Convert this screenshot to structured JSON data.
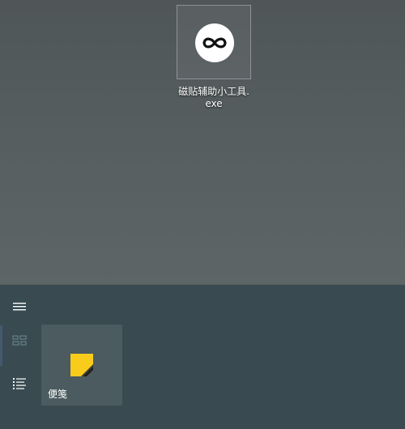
{
  "desktop": {
    "icon": {
      "name": "infinity-icon",
      "label": "磁贴辅助小工具.exe"
    }
  },
  "start_menu": {
    "rail": [
      {
        "name": "hamburger-menu-icon"
      },
      {
        "name": "tiles-grid-icon"
      },
      {
        "name": "all-apps-list-icon"
      }
    ],
    "tiles": [
      {
        "label": "便笺",
        "icon": "sticky-notes-icon",
        "icon_color": "#f9cc1b"
      }
    ]
  },
  "colors": {
    "desktop_bg": "#575f61",
    "start_bg": "#394b51",
    "tile_bg": "#4b5b60",
    "accent": "#f9cc1b"
  }
}
